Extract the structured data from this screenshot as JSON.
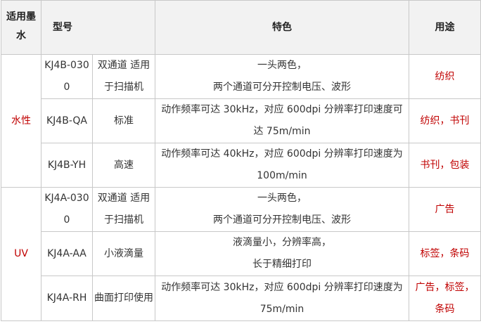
{
  "headers": {
    "ink": "适用墨水",
    "model": "型号",
    "features": "特色",
    "usage": "用途"
  },
  "groups": [
    {
      "ink": "水性",
      "rows": [
        {
          "model": "KJ4B-0300",
          "name": "双通道 适用于扫描机",
          "features": "一头两色，\n两个通道可分开控制电压、波形",
          "usage": "纺织"
        },
        {
          "model": "KJ4B-QA",
          "name": "标准",
          "features": "动作频率可达 30kHz，对应 600dpi 分辨率打印速度可达 75m/min",
          "usage": "纺织，书刊"
        },
        {
          "model": "KJ4B-YH",
          "name": "高速",
          "features": "动作频率可达 40kHz，对应 600dpi 分辨率打印速度为 100m/min",
          "usage": "书刊，包装"
        }
      ]
    },
    {
      "ink": "UV",
      "rows": [
        {
          "model": "KJ4A-0300",
          "name": "双通道 适用于扫描机",
          "features": "一头两色，\n两个通道可分开控制电压、波形",
          "usage": "广告"
        },
        {
          "model": "KJ4A-AA",
          "name": "小液滴量",
          "features": "液滴量小，分辨率高，\n长于精细打印",
          "usage": "标签，条码"
        },
        {
          "model": "KJ4A-RH",
          "name": "曲面打印使用",
          "features": "动作频率可达 30kHz，对应 600dpi 分辨率打印速度为 75m/min",
          "usage": "广告，标签，条码"
        }
      ]
    }
  ],
  "colors": {
    "accent_red": "#c00000",
    "header_bg": "#f2f2f2",
    "border": "#c8c8c8",
    "text": "#333333"
  }
}
